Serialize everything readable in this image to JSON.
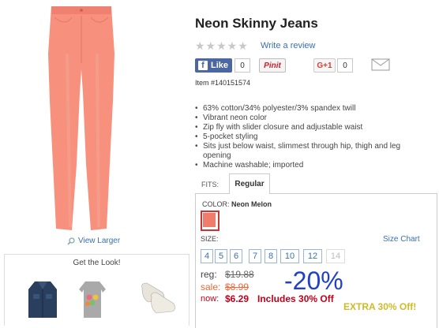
{
  "product": {
    "title": "Neon Skinny Jeans",
    "item_number": "Item #140151574",
    "image_icon": "jeans-image",
    "swatch_color": "#f07c6c"
  },
  "reviews": {
    "stars_text": "★★★★★",
    "write_review": "Write a review"
  },
  "social": {
    "fb_icon": "f",
    "fb_label": "Like",
    "fb_count": "0",
    "pin_label": "Pinit",
    "gplus_label": "G+1",
    "gplus_count": "0"
  },
  "view_larger": "View Larger",
  "get_the_look": {
    "title": "Get the Look!"
  },
  "features": [
    "63% cotton/34% polyester/3% spandex twill",
    "Vibrant neon color",
    "Zip fly with slider closure and adjustable waist",
    "5-pocket styling",
    "Sits just below waist, slimmest through hip, thigh and leg opening",
    "Machine washable; imported"
  ],
  "fits": {
    "label": "FITS:",
    "selected": "Regular"
  },
  "color": {
    "label": "COLOR:",
    "value": "Neon Melon"
  },
  "size": {
    "label": "SIZE:",
    "chart_link": "Size Chart",
    "options": [
      "4",
      "5",
      "6",
      "7",
      "8",
      "10",
      "12",
      "14"
    ]
  },
  "pricing": {
    "reg_label": "reg:",
    "reg_value": "$19.88",
    "sale_label": "sale:",
    "sale_value": "$8.99",
    "now_label": "now:",
    "now_value": "$6.29",
    "includes": "Includes 30% Off",
    "percent_off": "-20%",
    "extra": "EXTRA 30% Off!"
  }
}
